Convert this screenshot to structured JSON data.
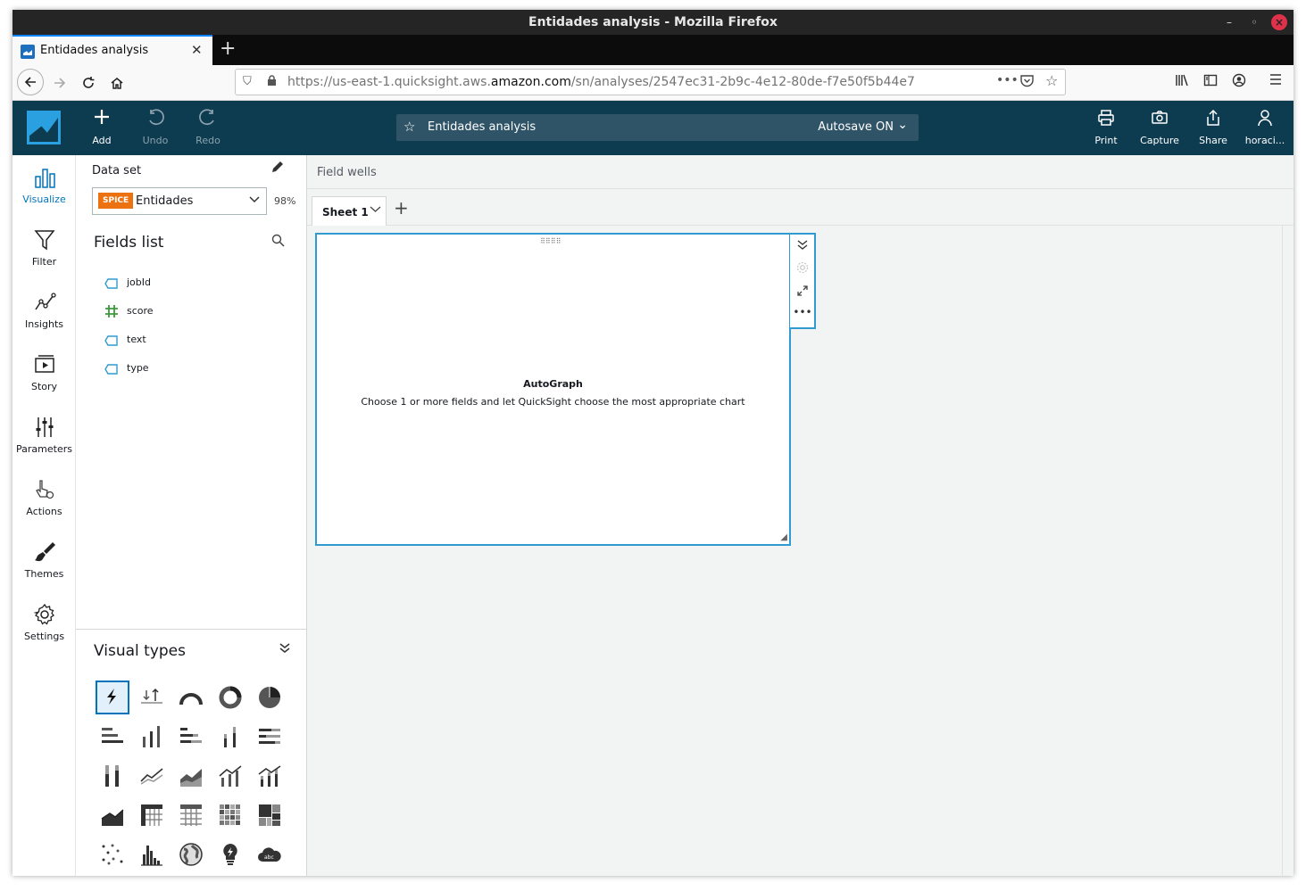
{
  "browser": {
    "window_title": "Entidades analysis - Mozilla Firefox",
    "tab_title": "Entidades analysis",
    "url_prefix": "https://us-east-1.quicksight.aws.",
    "url_domain": "amazon.com",
    "url_suffix": "/sn/analyses/2547ec31-2b9c-4e12-80de-f7e50f5b44e7"
  },
  "header": {
    "add_label": "Add",
    "undo_label": "Undo",
    "redo_label": "Redo",
    "analysis_name": "Entidades analysis",
    "autosave_label": "Autosave ON",
    "print_label": "Print",
    "capture_label": "Capture",
    "share_label": "Share",
    "user_label": "horaci..."
  },
  "leftnav": {
    "items": [
      {
        "label": "Visualize",
        "icon": "bar-chart-icon"
      },
      {
        "label": "Filter",
        "icon": "funnel-icon"
      },
      {
        "label": "Insights",
        "icon": "trend-icon"
      },
      {
        "label": "Story",
        "icon": "play-slides-icon"
      },
      {
        "label": "Parameters",
        "icon": "sliders-icon"
      },
      {
        "label": "Actions",
        "icon": "pointer-gear-icon"
      },
      {
        "label": "Themes",
        "icon": "brush-icon"
      },
      {
        "label": "Settings",
        "icon": "gear-icon"
      }
    ]
  },
  "dataset": {
    "section_label": "Data set",
    "badge": "SPICE",
    "name": "Entidades",
    "percent": "98%"
  },
  "fields_list": {
    "title": "Fields list",
    "fields": [
      {
        "name": "jobId",
        "type": "dimension"
      },
      {
        "name": "score",
        "type": "measure"
      },
      {
        "name": "text",
        "type": "dimension"
      },
      {
        "name": "type",
        "type": "dimension"
      }
    ]
  },
  "visual_types": {
    "title": "Visual types",
    "selected": "autograph",
    "items": [
      "autograph",
      "kpi",
      "gauge",
      "donut",
      "pie",
      "horizontal-bar",
      "vertical-bar",
      "horizontal-stacked-bar",
      "vertical-stacked-bar",
      "horizontal-100-bar",
      "vertical-100-bar",
      "line",
      "area-line",
      "combo-bar-line",
      "combo-stacked-bar-line",
      "area",
      "pivot-table",
      "table",
      "heat-map",
      "tree-map",
      "scatter",
      "histogram",
      "map",
      "insight",
      "word-cloud"
    ]
  },
  "canvas": {
    "field_wells_label": "Field wells",
    "sheet_tab": "Sheet 1",
    "autograph_title": "AutoGraph",
    "autograph_desc": "Choose 1 or more fields and let QuickSight choose the most appropriate chart"
  },
  "colors": {
    "header_bg": "#0d3b4f",
    "accent": "#0073bb",
    "spice": "#ec7211",
    "selection": "#2f9bd0"
  }
}
